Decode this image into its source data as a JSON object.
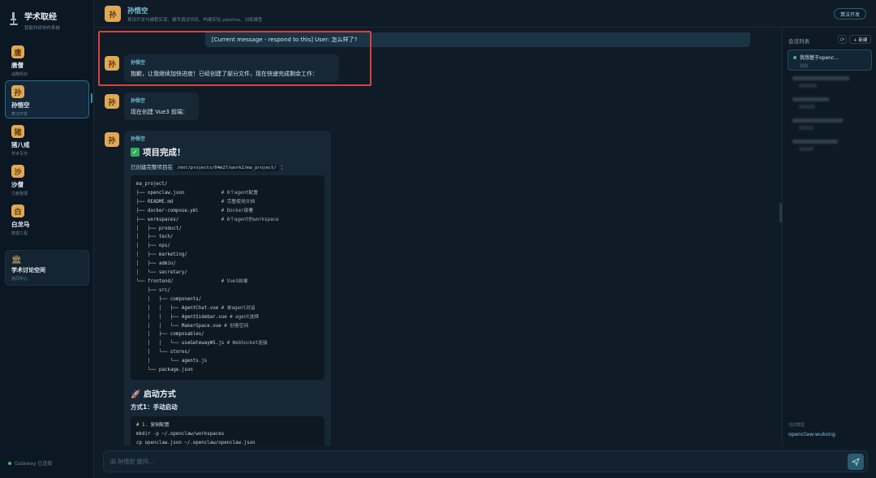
{
  "brand": {
    "title": "学术取经",
    "subtitle": "智能科研协作系统"
  },
  "agents": [
    {
      "name": "唐僧",
      "role": "战略规划",
      "glyph": "唐"
    },
    {
      "name": "孙悟空",
      "role": "算法开发",
      "glyph": "孙"
    },
    {
      "name": "猪八戒",
      "role": "学术写作",
      "glyph": "猪"
    },
    {
      "name": "沙僧",
      "role": "文献整理",
      "glyph": "沙"
    },
    {
      "name": "白龙马",
      "role": "数据工程",
      "glyph": "白"
    }
  ],
  "space": {
    "title": "学术讨论空间",
    "subtitle": "协同中心",
    "icon": "temple-icon"
  },
  "gateway": {
    "label": "Gateway 已连接",
    "color": "#3fbf6a"
  },
  "header": {
    "name": "孙悟空",
    "subtitle": "算法开发与编程实现、编写调试代码、构建实验 pipeline、训练模型",
    "button": "算法开发"
  },
  "chat": {
    "user_message": "[Current message - respond to this] User: 怎么样了?",
    "messages": [
      {
        "name": "孙悟空",
        "text": "抱歉，让我继续加快进度！已经创建了部分文件，现在快速完成剩余工作："
      },
      {
        "name": "孙悟空",
        "text": "现在创建 Vue3 前端："
      }
    ],
    "final": {
      "name": "孙悟空",
      "heading": "项目完成！",
      "created_prefix": "已创建完整项目在",
      "created_path": "/mnt/projects/04m27/work2/ma_project/",
      "created_suffix": "：",
      "tree": [
        {
          "t": "ma_project/",
          "c": ""
        },
        {
          "t": "├── openclaw.json",
          "c": "# 6个agent配置"
        },
        {
          "t": "├── README.md",
          "c": "# 完整使用文档"
        },
        {
          "t": "├── docker-compose.yml",
          "c": "# Docker部署"
        },
        {
          "t": "├── workspaces/",
          "c": "# 6个agent的workspace"
        },
        {
          "t": "│   ├── product/",
          "c": ""
        },
        {
          "t": "│   ├── tech/",
          "c": ""
        },
        {
          "t": "│   ├── ops/",
          "c": ""
        },
        {
          "t": "│   ├── marketing/",
          "c": ""
        },
        {
          "t": "│   ├── admin/",
          "c": ""
        },
        {
          "t": "│   └── secretary/",
          "c": ""
        },
        {
          "t": "└── frontend/",
          "c": "# Vue3前端"
        },
        {
          "t": "    ├── src/",
          "c": ""
        },
        {
          "t": "    │   ├── components/",
          "c": ""
        },
        {
          "t": "    │   │   ├── AgentChat.vue",
          "c": "# 单agent对话"
        },
        {
          "t": "    │   │   ├── AgentSidebar.vue",
          "c": "# agent选择"
        },
        {
          "t": "    │   │   └── MakerSpace.vue",
          "c": "# 创客空间"
        },
        {
          "t": "    │   ├── composables/",
          "c": ""
        },
        {
          "t": "    │   │   └── useGatewayWS.js",
          "c": "# WebSocket连接"
        },
        {
          "t": "    │   └── stores/",
          "c": ""
        },
        {
          "t": "    │       └── agents.js",
          "c": ""
        },
        {
          "t": "    └── package.json",
          "c": ""
        }
      ],
      "start_heading": "启动方式",
      "way_heading": "方式1：手动启动",
      "start_code": [
        "# 1. 复制配置",
        "mkdir -p ~/.openclaw/workspaces",
        "cp openclaw.json ~/.openclaw/openclaw.json"
      ]
    }
  },
  "input": {
    "placeholder": "向 孙悟空 提问..."
  },
  "sessions": {
    "title": "会话列表",
    "new_label": "+ 新建",
    "items": [
      {
        "title": "我想基于openc...",
        "sub": "刚刚",
        "active": true
      }
    ],
    "blurred_count": 4
  },
  "model": {
    "label": "当前模型",
    "value": "openclaw:wukong"
  }
}
